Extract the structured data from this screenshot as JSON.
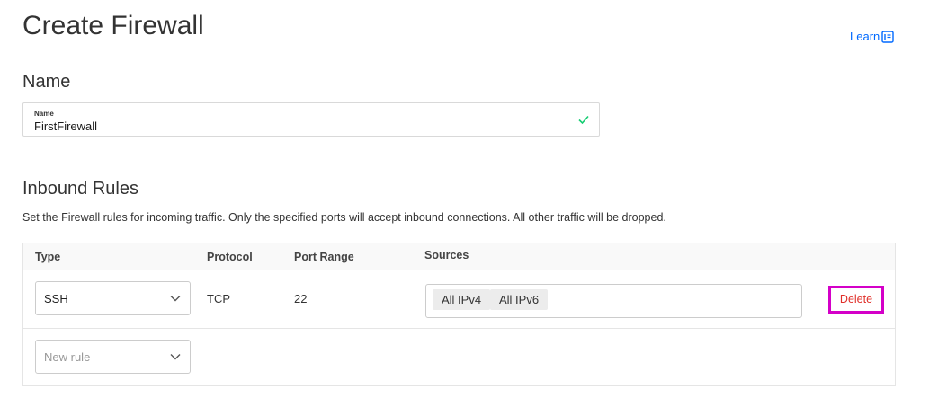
{
  "page": {
    "title": "Create Firewall",
    "learn_label": "Learn"
  },
  "name_section": {
    "heading": "Name",
    "field_label": "Name",
    "field_value": "FirstFirewall"
  },
  "inbound": {
    "heading": "Inbound Rules",
    "description": "Set the Firewall rules for incoming traffic. Only the specified ports will accept inbound connections. All other traffic will be dropped.",
    "columns": [
      "Type",
      "Protocol",
      "Port Range",
      "Sources"
    ],
    "rules": [
      {
        "type": "SSH",
        "protocol": "TCP",
        "port_range": "22",
        "sources": [
          "All IPv4",
          "All IPv6"
        ],
        "delete_label": "Delete"
      }
    ],
    "new_rule_placeholder": "New rule"
  },
  "colors": {
    "link": "#0069ff",
    "valid": "#15cd72",
    "delete_text": "#e0302a",
    "highlight": "#d400c8"
  }
}
